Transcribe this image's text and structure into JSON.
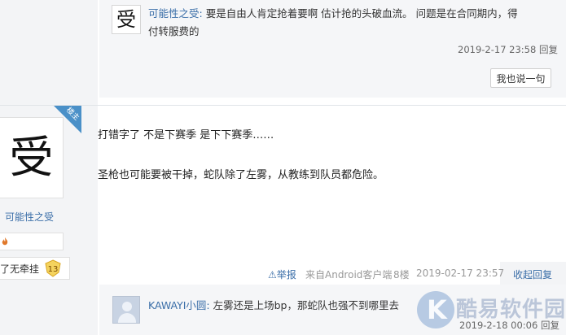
{
  "prev_reply": {
    "avatar_glyph": "受",
    "username": "可能性之受:",
    "text_line1": "要是自由人肯定抢着要啊 估计抢的头破血流。 问题是在合同期内，得",
    "text_line2": "付转服费的",
    "timestamp": "2019-2-17 23:58",
    "reply_label": "回复",
    "say_button": "我也说一句"
  },
  "user": {
    "avatar_glyph": "受",
    "owner_badge": "楼主",
    "name": "可能性之受",
    "medal_text": "了无牵挂",
    "level": "13"
  },
  "post": {
    "line1": "打错字了 不是下赛季 是下下赛季……",
    "line2": "圣枪也可能要被干掉，蛇队除了左雾，从教练到队员都危险。"
  },
  "footer": {
    "report": "举报",
    "source": "来自Android客户端",
    "floor": "8楼",
    "timestamp": "2019-02-17 23:57",
    "fold_reply": "收起回复"
  },
  "reply2": {
    "username": "KAWAYI小圆:",
    "text": "左雾还是上场bp，那蛇队也强不到哪里去",
    "timestamp": "2019-2-18 00:06",
    "reply_label": "回复"
  },
  "watermark": {
    "logo_letter": "K",
    "text": "酷易软件园"
  },
  "icons": {
    "report": "warning-icon",
    "fire": "fire-icon",
    "level": "level-badge-icon",
    "default_avatar": "default-avatar-icon"
  },
  "colors": {
    "link_blue": "#3a6ea8",
    "badge_blue": "#4a90c8",
    "panel_gray": "#f5f6f8",
    "side_gray": "#f3f4f6"
  }
}
